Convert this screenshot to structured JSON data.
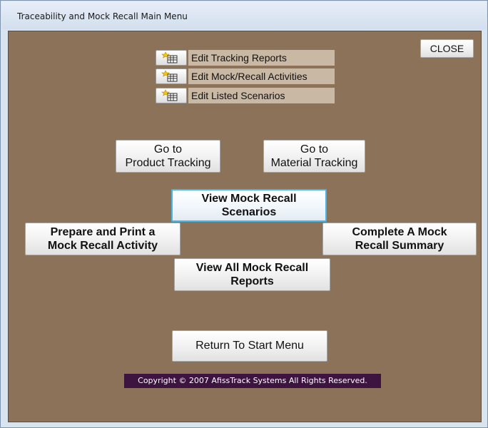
{
  "window": {
    "title": "Traceability and Mock Recall Main Menu"
  },
  "toolbar": {
    "close_label": "CLOSE"
  },
  "edit_items": [
    {
      "label": "Edit Tracking Reports",
      "icon": "form-edit-icon"
    },
    {
      "label": "Edit Mock/Recall Activities",
      "icon": "form-edit-icon"
    },
    {
      "label": "Edit Listed Scenarios",
      "icon": "form-edit-icon"
    }
  ],
  "nav": {
    "product_tracking": "Go to\nProduct Tracking",
    "material_tracking": "Go to\nMaterial Tracking"
  },
  "actions": {
    "view_scenarios": "View Mock Recall\nScenarios",
    "prepare_print": "Prepare and Print a\nMock Recall Activity",
    "complete_summary": "Complete A Mock\nRecall Summary",
    "view_reports": "View All Mock Recall\nReports",
    "return_start": "Return To Start Menu"
  },
  "footer": {
    "copyright": "Copyright © 2007 AfissTrack Systems All Rights Reserved."
  },
  "colors": {
    "form_background": "#8b7258",
    "label_background": "#c9b8a4",
    "copyright_background": "#3d1340",
    "focus_border": "#46b7e6"
  }
}
